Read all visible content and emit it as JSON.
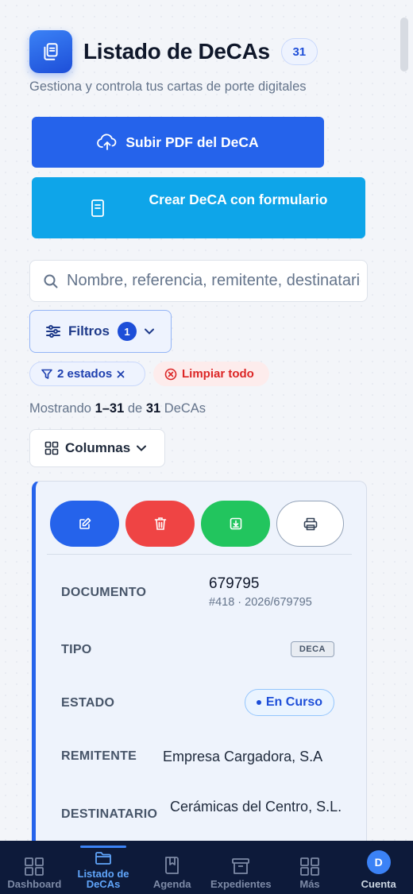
{
  "header": {
    "title": "Listado de DeCAs",
    "count": "31",
    "subtitle": "Gestiona y controla tus cartas de porte digitales"
  },
  "actions": {
    "upload_label": "Subir PDF del DeCA",
    "create_label": "Crear DeCA con formulario"
  },
  "search": {
    "placeholder": "Nombre, referencia, remitente, destinatario"
  },
  "filters": {
    "label": "Filtros",
    "count": "1",
    "chips": {
      "states": "2 estados",
      "clear": "Limpiar todo"
    }
  },
  "results": {
    "prefix": "Mostrando",
    "range": "1–31",
    "of": "de",
    "total": "31",
    "suffix": "DeCAs"
  },
  "columns_label": "Columnas",
  "card": {
    "labels": {
      "document": "DOCUMENTO",
      "type": "TIPO",
      "state": "ESTADO",
      "sender": "REMITENTE",
      "recipient": "DESTINATARIO"
    },
    "document_number": "679795",
    "document_sub": "#418  ·  2026/679795",
    "type": "DECA",
    "state": "En Curso",
    "sender": "Empresa Cargadora, S.A",
    "recipient": "Cerámicas del Centro, S.L."
  },
  "nav": {
    "items": [
      {
        "label": "Dashboard"
      },
      {
        "label": "Listado de DeCAs"
      },
      {
        "label": "Agenda"
      },
      {
        "label": "Expedientes"
      },
      {
        "label": "Más"
      },
      {
        "label": "Cuenta"
      }
    ],
    "avatar_initial": "D"
  },
  "colors": {
    "primary": "#2563eb",
    "accent": "#0ea5e9",
    "danger": "#ef4444",
    "success": "#22c55e",
    "nav_bg": "#0d1a3a"
  }
}
